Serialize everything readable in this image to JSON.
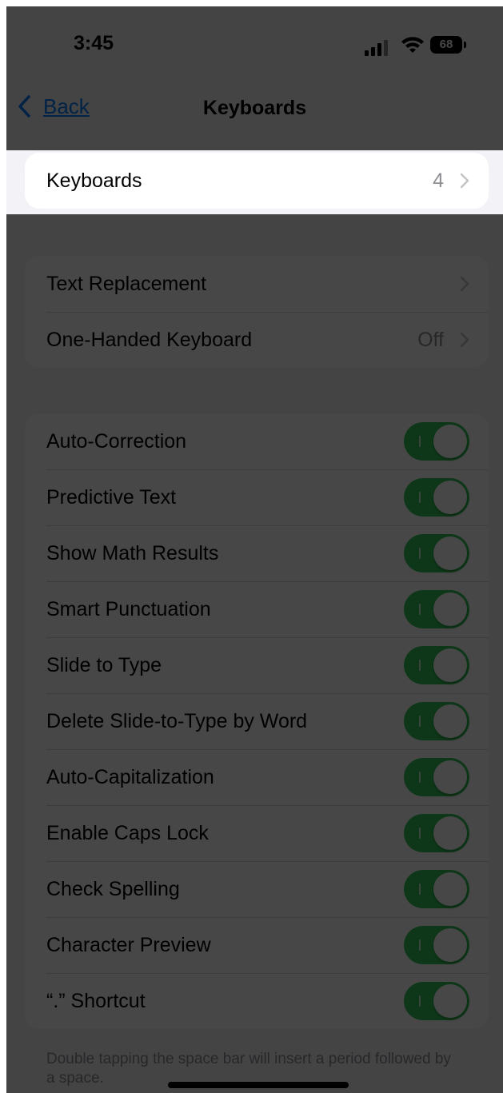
{
  "status_bar": {
    "time": "3:45",
    "battery_level": "68"
  },
  "nav": {
    "back_label": "Back",
    "title": "Keyboards"
  },
  "group1": {
    "rows": [
      {
        "label": "Keyboards",
        "value": "4"
      }
    ]
  },
  "group2": {
    "rows": [
      {
        "label": "Text Replacement",
        "value": ""
      },
      {
        "label": "One-Handed Keyboard",
        "value": "Off"
      }
    ]
  },
  "group3": {
    "rows": [
      {
        "label": "Auto-Correction",
        "on": true
      },
      {
        "label": "Predictive Text",
        "on": true
      },
      {
        "label": "Show Math Results",
        "on": true
      },
      {
        "label": "Smart Punctuation",
        "on": true
      },
      {
        "label": "Slide to Type",
        "on": true
      },
      {
        "label": "Delete Slide-to-Type by Word",
        "on": true
      },
      {
        "label": "Auto-Capitalization",
        "on": true
      },
      {
        "label": "Enable Caps Lock",
        "on": true
      },
      {
        "label": "Check Spelling",
        "on": true
      },
      {
        "label": "Character Preview",
        "on": true
      },
      {
        "label": "“.” Shortcut",
        "on": true
      }
    ]
  },
  "footnote": "Double tapping the space bar will insert a period followed by a space.",
  "colors": {
    "accent": "#007aff",
    "toggle_on": "#34c759",
    "background": "#f2f2f7",
    "dim_overlay": "rgba(0,0,0,0.72)"
  }
}
